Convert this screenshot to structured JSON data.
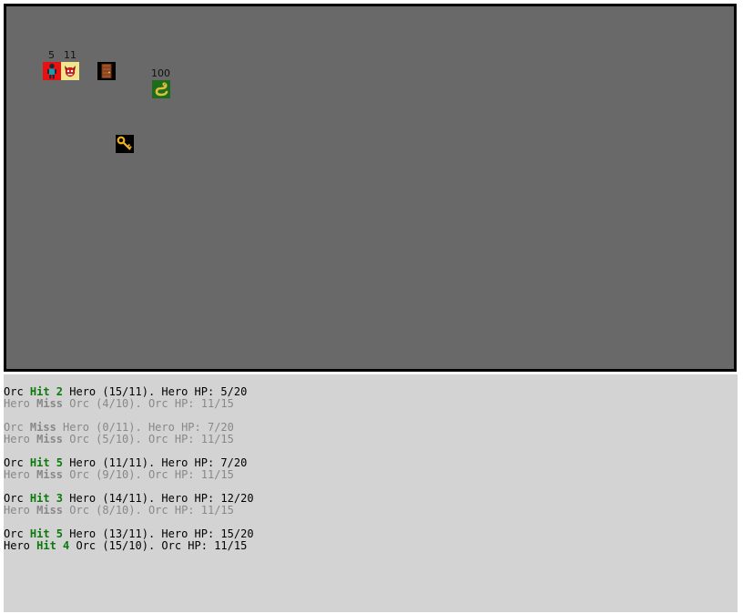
{
  "board": {
    "hero_label": "5",
    "orc_label": "11",
    "snake_label": "100",
    "entities": [
      "hero-icon",
      "orc-icon",
      "door-icon",
      "snake-icon",
      "key-icon"
    ],
    "colors": {
      "floor": "#696969",
      "hero_bg": "#e81010",
      "orc_bg": "#f0e68c",
      "snake_bg": "#1e6b1e",
      "key_bg": "#000000",
      "door_bg": "#000000"
    }
  },
  "log": [
    {
      "state": "cur",
      "a": "Orc ",
      "verb": "Hit 2",
      "b": " Hero (15/11). Hero HP: 5/20"
    },
    {
      "state": "old",
      "a": "Hero ",
      "verb": "Miss",
      "b": " Orc (4/10). Orc HP: 11/15"
    },
    {
      "state": "old",
      "a": "Orc ",
      "verb": "Miss",
      "b": " Hero (0/11). Hero HP: 7/20"
    },
    {
      "state": "old",
      "a": "Hero ",
      "verb": "Miss",
      "b": " Orc (5/10). Orc HP: 11/15"
    },
    {
      "state": "cur",
      "a": "Orc ",
      "verb": "Hit 5",
      "b": " Hero (11/11). Hero HP: 7/20"
    },
    {
      "state": "old",
      "a": "Hero ",
      "verb": "Miss",
      "b": " Orc (9/10). Orc HP: 11/15"
    },
    {
      "state": "cur",
      "a": "Orc ",
      "verb": "Hit 3",
      "b": " Hero (14/11). Hero HP: 12/20"
    },
    {
      "state": "old",
      "a": "Hero ",
      "verb": "Miss",
      "b": " Orc (8/10). Orc HP: 11/15"
    },
    {
      "state": "cur",
      "a": "Orc ",
      "verb": "Hit 5",
      "b": " Hero (13/11). Hero HP: 15/20"
    },
    {
      "state": "cur",
      "a": "Hero ",
      "verb": "Hit 4",
      "b": " Orc (15/10). Orc HP: 11/15"
    }
  ]
}
